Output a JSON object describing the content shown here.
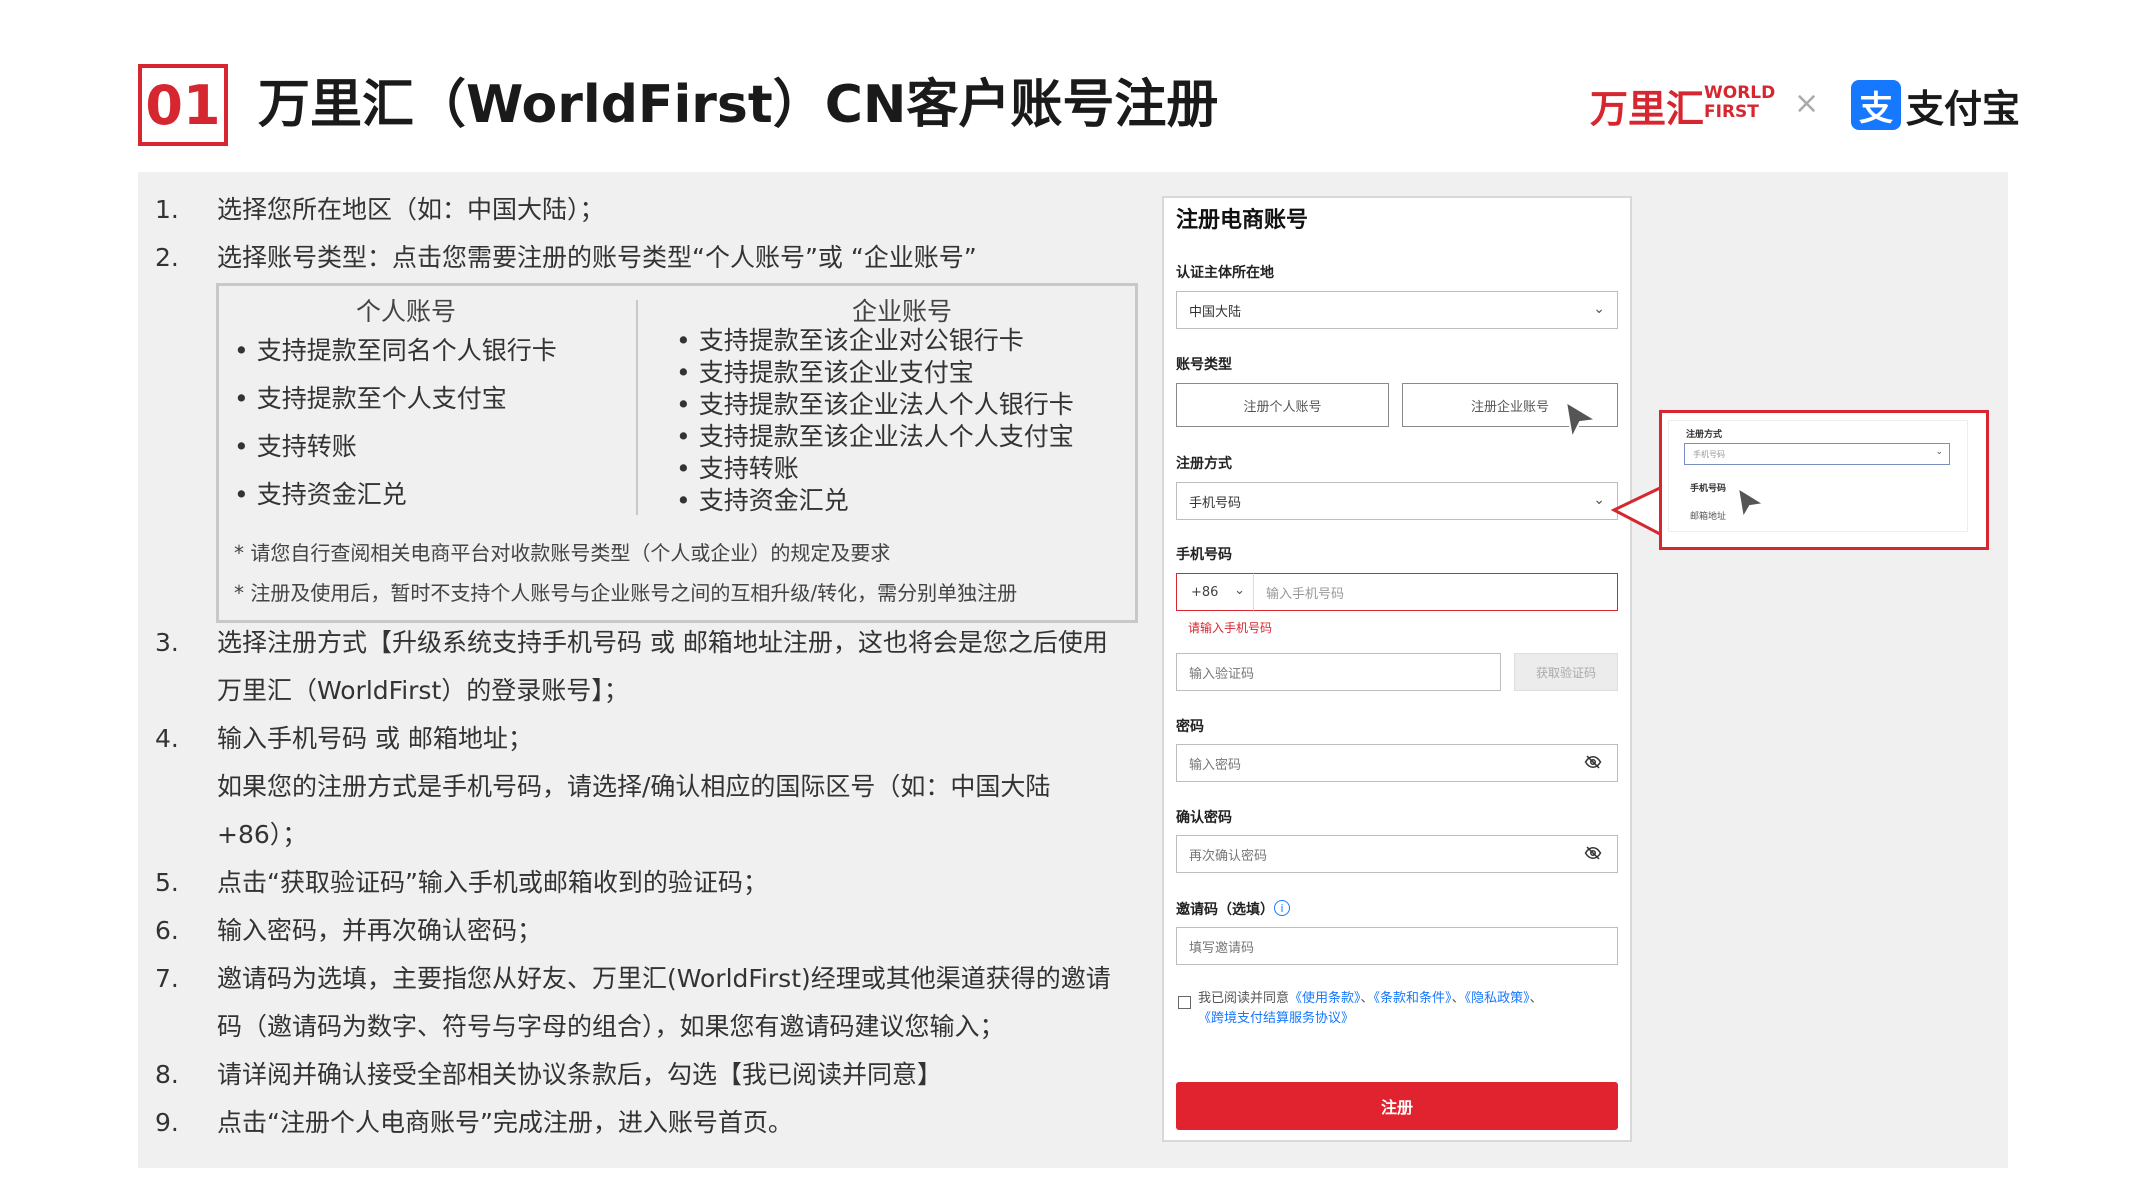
{
  "header": {
    "number": "01",
    "title": "万里汇（WorldFirst）CN客户账号注册",
    "logo_worldfirst_cn": "万里汇",
    "logo_worldfirst_en1": "WORLD",
    "logo_worldfirst_en2": "FIRST",
    "logo_separator": "×",
    "logo_alipay_glyph": "支",
    "logo_alipay": "支付宝"
  },
  "steps": {
    "s1": {
      "num": "1.",
      "text": "选择您所在地区（如：中国大陆）；"
    },
    "s2": {
      "num": "2.",
      "text": "选择账号类型：点击您需要注册的账号类型“个人账号”或 “企业账号”"
    },
    "s3": {
      "num": "3.",
      "text": "选择注册方式【升级系统支持手机号码 或 邮箱地址注册，这也将会是您之后使用",
      "cont": "万里汇（WorldFirst）的登录账号】；"
    },
    "s4": {
      "num": "4.",
      "text": "输入手机号码 或 邮箱地址；",
      "cont1": "如果您的注册方式是手机号码，请选择/确认相应的国际区号（如：中国大陆",
      "cont2": "+86）；"
    },
    "s5": {
      "num": "5.",
      "text": "点击“获取验证码”输入手机或邮箱收到的验证码；"
    },
    "s6": {
      "num": "6.",
      "text": "输入密码，并再次确认密码；"
    },
    "s7": {
      "num": "7.",
      "text": "邀请码为选填，主要指您从好友、万里汇(WorldFirst)经理或其他渠道获得的邀请",
      "cont": "码（邀请码为数字、符号与字母的组合），如果您有邀请码建议您输入；"
    },
    "s8": {
      "num": "8.",
      "text": "请详阅并确认接受全部相关协议条款后，勾选【我已阅读并同意】"
    },
    "s9": {
      "num": "9.",
      "text": "点击“注册个人电商账号”完成注册，进入账号首页。"
    }
  },
  "account_types": {
    "personal_title": "个人账号",
    "personal_items": [
      "• 支持提款至同名个人银行卡",
      "• 支持提款至个人支付宝",
      "• 支持转账",
      "• 支持资金汇兑"
    ],
    "business_title": "企业账号",
    "business_items": [
      "•  支持提款至该企业对公银行卡",
      "•  支持提款至该企业支付宝",
      "•  支持提款至该企业法人个人银行卡",
      "•  支持提款至该企业法人个人支付宝",
      "•  支持转账",
      "•  支持资金汇兑"
    ],
    "note1": "* 请您自行查阅相关电商平台对收款账号类型（个人或企业）的规定及要求",
    "note2": "* 注册及使用后，暂时不支持个人账号与企业账号之间的互相升级/转化，需分别单独注册"
  },
  "form": {
    "title": "注册电商账号",
    "region_label": "认证主体所在地",
    "region_value": "中国大陆",
    "type_label": "账号类型",
    "btn_personal": "注册个人账号",
    "btn_business": "注册企业账号",
    "method_label": "注册方式",
    "method_value": "手机号码",
    "phone_label": "手机号码",
    "country_code": "+86",
    "phone_placeholder": "输入手机号码",
    "phone_error": "请输入手机号码",
    "code_placeholder": "输入验证码",
    "code_button": "获取验证码",
    "password_label": "密码",
    "password_placeholder": "输入密码",
    "confirm_label": "确认密码",
    "confirm_placeholder": "再次确认密码",
    "invite_label": "邀请码（选填）",
    "invite_placeholder": "填写邀请码",
    "agree_prefix": "我已阅读并同意",
    "agree_link1": "《使用条款》",
    "agree_sep1": "、",
    "agree_link2": "《条款和条件》",
    "agree_sep2": "、",
    "agree_link3": "《隐私政策》",
    "agree_sep3": "、",
    "agree_link4": "《跨境支付结算服务协议》",
    "submit": "注册"
  },
  "callout": {
    "label": "注册方式",
    "select_value": "手机号码",
    "option1": "手机号码",
    "option2": "邮箱地址"
  },
  "colors": {
    "brand_red": "#d6262f",
    "submit_red": "#e1222f",
    "link_blue": "#1677ff",
    "panel_grey": "#f0f0f0"
  }
}
